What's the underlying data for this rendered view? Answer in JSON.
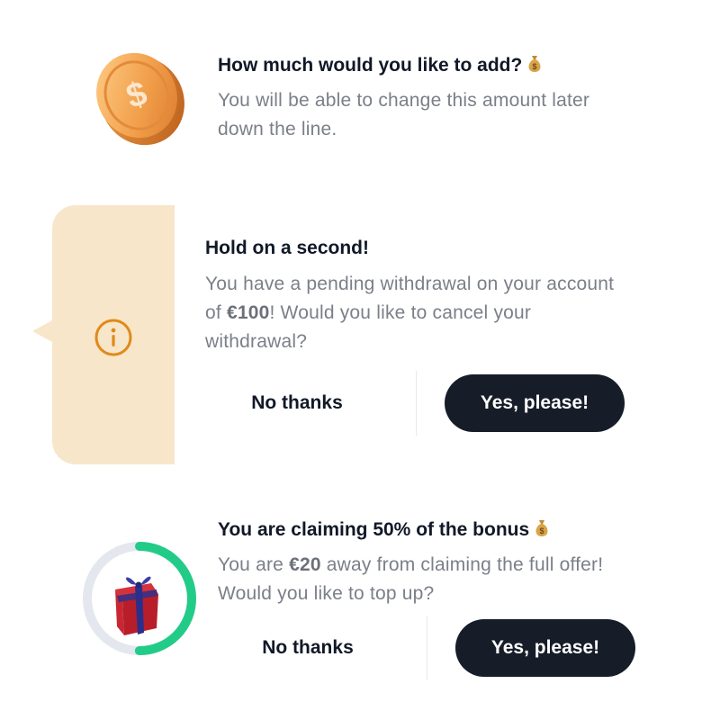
{
  "card1": {
    "title": "How much would you like to add?",
    "title_icon": "money-bag-icon",
    "body": "You will be able to change this amount later down the line.",
    "image": "coin-icon"
  },
  "card2": {
    "title": "Hold on a second!",
    "body_part1": "You have a pending withdrawal on your account of ",
    "amount": "€100",
    "body_part2": "! Would you like to cancel your withdrawal?",
    "icon": "info-icon",
    "no_label": "No thanks",
    "yes_label": "Yes, please!",
    "colors": {
      "tab": "#f8e6ca",
      "icon": "#e08a1a"
    }
  },
  "card3": {
    "title": "You are claiming 50% of the bonus",
    "title_icon": "money-bag-icon",
    "body_part1": "You are ",
    "amount": "€20",
    "body_part2": " away from claiming the full offer! Would you like to top up?",
    "progress": 0.5,
    "image": "gift-icon",
    "no_label": "No thanks",
    "yes_label": "Yes, please!",
    "colors": {
      "progress": "#22cc88",
      "track": "#e4e7ee"
    }
  },
  "colors": {
    "button_dark": "#161c28",
    "title": "#111827",
    "body": "#7b7f88"
  }
}
